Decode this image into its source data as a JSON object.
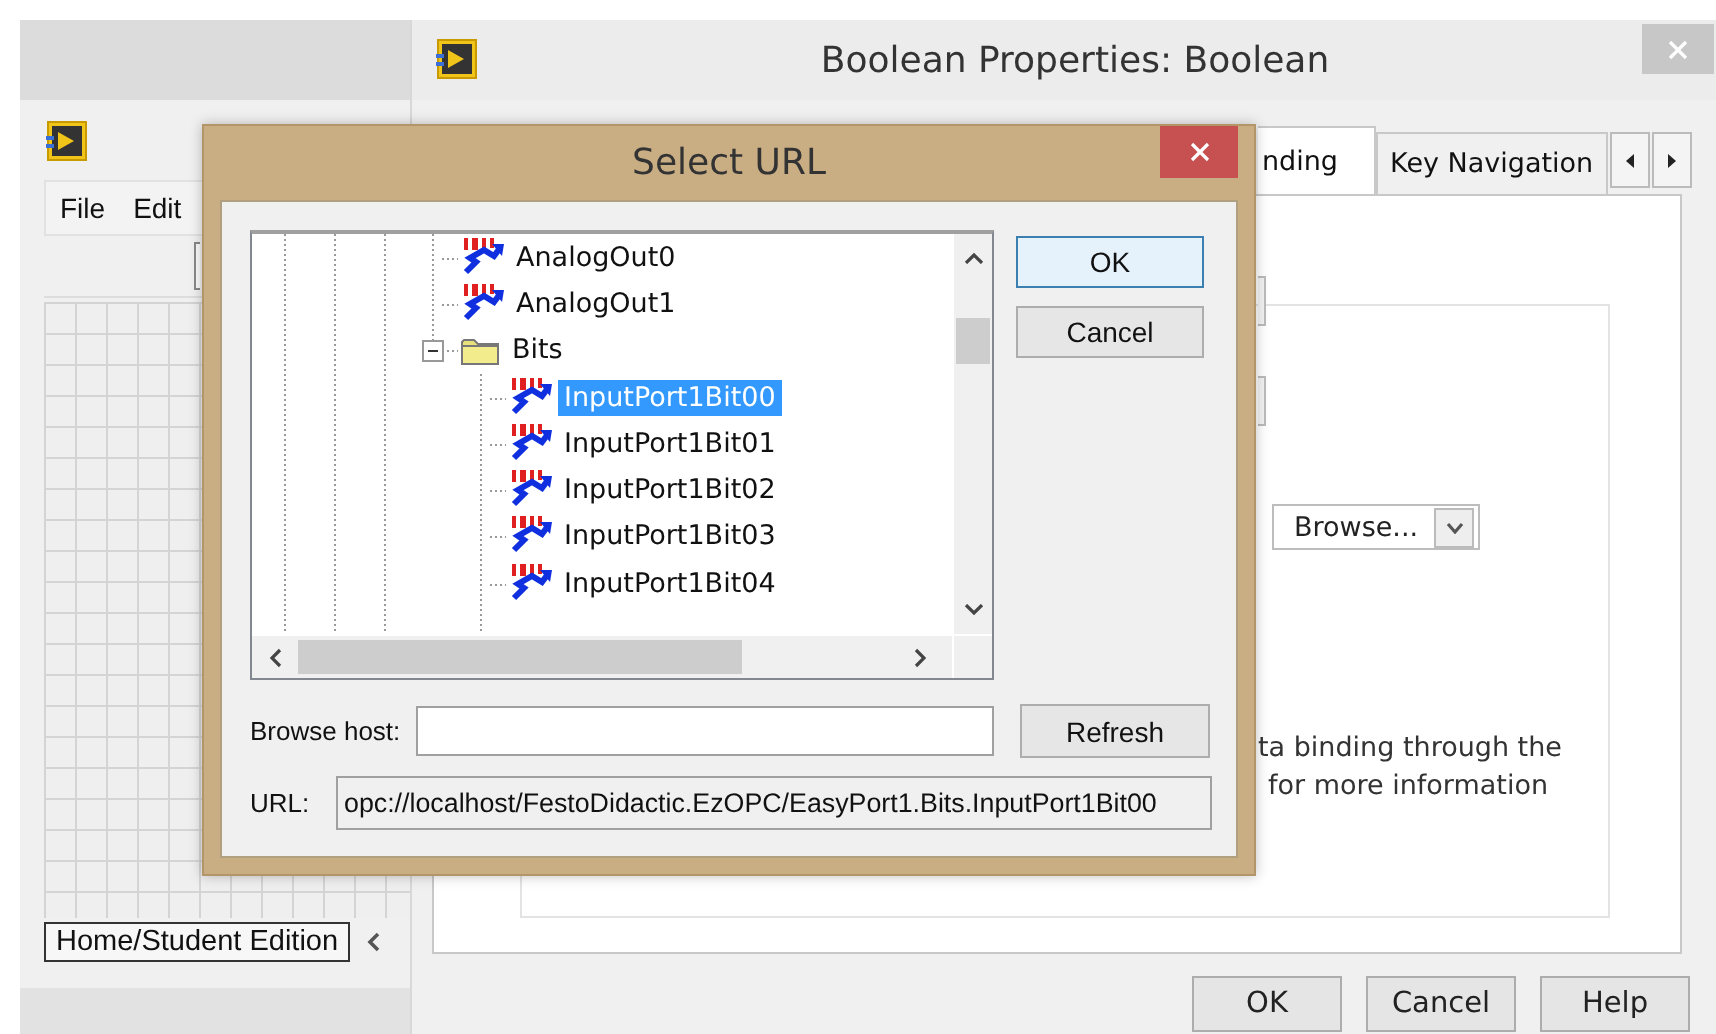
{
  "back_window": {
    "menu": [
      {
        "label": "File"
      },
      {
        "label": "Edit"
      }
    ],
    "status": "Home/Student Edition"
  },
  "properties_window": {
    "title": "Boolean Properties: Boolean",
    "tabs": [
      {
        "label": "nding",
        "selected": true
      },
      {
        "label": "Key Navigation",
        "selected": false
      }
    ],
    "dropdown": {
      "value": "Browse..."
    },
    "help_lines": [
      "ta binding through the",
      "for more information"
    ],
    "buttons": [
      "OK",
      "Cancel",
      "Help"
    ]
  },
  "select_url": {
    "title": "Select URL",
    "tree": [
      {
        "label": "AnalogOut0",
        "kind": "item",
        "selected": false
      },
      {
        "label": "AnalogOut1",
        "kind": "item",
        "selected": false
      },
      {
        "label": "Bits",
        "kind": "folder",
        "expanded": true,
        "selected": false,
        "children": [
          {
            "label": "InputPort1Bit00",
            "kind": "item",
            "selected": true
          },
          {
            "label": "InputPort1Bit01",
            "kind": "item",
            "selected": false
          },
          {
            "label": "InputPort1Bit02",
            "kind": "item",
            "selected": false
          },
          {
            "label": "InputPort1Bit03",
            "kind": "item",
            "selected": false
          },
          {
            "label": "InputPort1Bit04",
            "kind": "item",
            "selected": false
          }
        ]
      }
    ],
    "buttons": [
      {
        "label": "OK",
        "default": true
      },
      {
        "label": "Cancel",
        "default": false
      }
    ],
    "browse_host_label": "Browse host:",
    "refresh": "Refresh",
    "url_label": "URL:",
    "url": "opc://localhost/FestoDidactic.EzOPC/EasyPort1.Bits.InputPort1Bit00"
  }
}
